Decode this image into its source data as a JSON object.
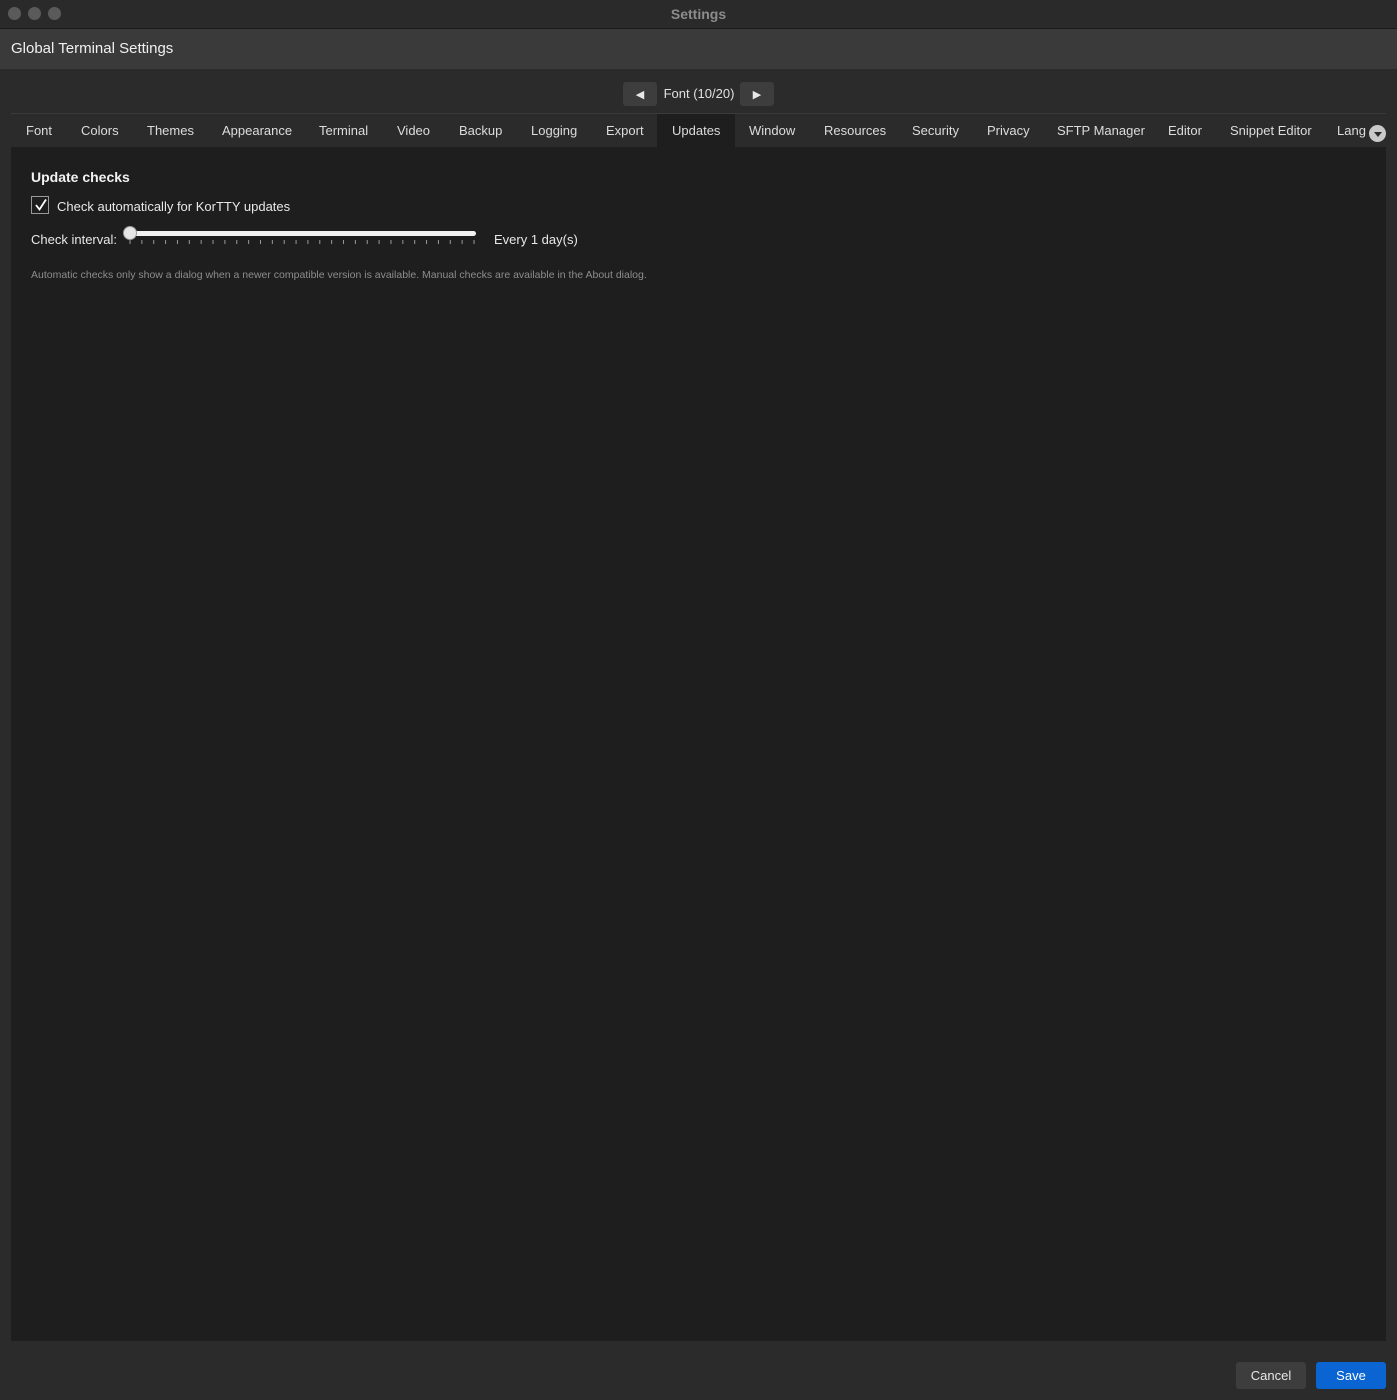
{
  "window": {
    "title": "Settings"
  },
  "header": {
    "title": "Global Terminal Settings"
  },
  "nav": {
    "label": "Font  (10/20)",
    "prev_icon": "◀",
    "next_icon": "▶"
  },
  "tabs": [
    {
      "label": "Font"
    },
    {
      "label": "Colors"
    },
    {
      "label": "Themes"
    },
    {
      "label": "Appearance"
    },
    {
      "label": "Terminal"
    },
    {
      "label": "Video"
    },
    {
      "label": "Backup"
    },
    {
      "label": "Logging"
    },
    {
      "label": "Export"
    },
    {
      "label": "Updates",
      "active": true
    },
    {
      "label": "Window"
    },
    {
      "label": "Resources"
    },
    {
      "label": "Security"
    },
    {
      "label": "Privacy"
    },
    {
      "label": "SFTP Manager"
    },
    {
      "label": "Editor"
    },
    {
      "label": "Snippet Editor"
    },
    {
      "label": "Lang"
    }
  ],
  "updates": {
    "section_title": "Update checks",
    "auto_check_label": "Check automatically for KorTTY updates",
    "auto_check_checked": true,
    "interval_label": "Check interval:",
    "interval_value_text": "Every 1 day(s)",
    "interval_days": 1,
    "interval_min": 1,
    "interval_max": 30,
    "hint": "Automatic checks only show a dialog when a newer compatible version is available. Manual checks are available in the About dialog."
  },
  "footer": {
    "cancel_label": "Cancel",
    "save_label": "Save"
  },
  "colors": {
    "accent": "#0a64d2",
    "active_tab": "#1e1e1e"
  }
}
